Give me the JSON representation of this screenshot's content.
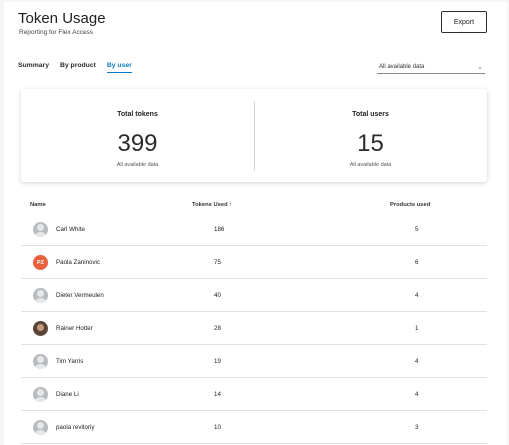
{
  "header": {
    "title": "Token Usage",
    "subtitle": "Reporting for Flex Access",
    "export_label": "Export"
  },
  "tabs": [
    {
      "label": "Summary",
      "active": false
    },
    {
      "label": "By product",
      "active": false
    },
    {
      "label": "By user",
      "active": true
    }
  ],
  "filter": {
    "value": "All available data",
    "icon": "chevron-down-icon"
  },
  "stats": {
    "tokens": {
      "label": "Total tokens",
      "value": "399",
      "note": "All available data"
    },
    "users": {
      "label": "Total users",
      "value": "15",
      "note": "All available data"
    }
  },
  "table": {
    "headers": {
      "name": "Name",
      "tokens": "Tokens Used",
      "sort": "↑",
      "products": "Products used"
    },
    "rows": [
      {
        "name": "Carl White",
        "tokens": "186",
        "products": "5",
        "avatar": "generic",
        "initials": ""
      },
      {
        "name": "Paola Zaninovic",
        "tokens": "75",
        "products": "6",
        "avatar": "initials",
        "initials": "PZ"
      },
      {
        "name": "Dieter Vermeulen",
        "tokens": "40",
        "products": "4",
        "avatar": "generic",
        "initials": ""
      },
      {
        "name": "Rainer Hotter",
        "tokens": "28",
        "products": "1",
        "avatar": "photo",
        "initials": ""
      },
      {
        "name": "Tim Yarris",
        "tokens": "19",
        "products": "4",
        "avatar": "generic",
        "initials": ""
      },
      {
        "name": "Diane Li",
        "tokens": "14",
        "products": "4",
        "avatar": "generic",
        "initials": ""
      },
      {
        "name": "paola revitoriy",
        "tokens": "10",
        "products": "3",
        "avatar": "generic",
        "initials": ""
      }
    ]
  },
  "colors": {
    "accent": "#0a79c6",
    "initials_avatar": "#e8603c"
  }
}
